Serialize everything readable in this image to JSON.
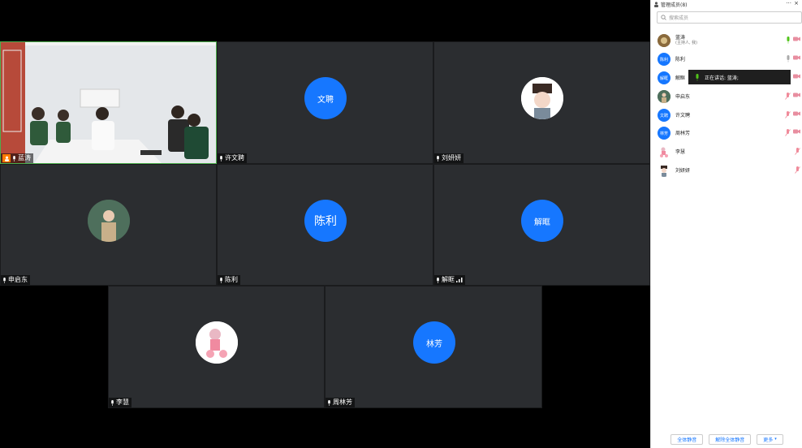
{
  "panel": {
    "title": "管理成员(8)",
    "more": "···",
    "close": "×",
    "search_placeholder": "搜索成员",
    "members": [
      {
        "name": "蓝涛",
        "sub": "(主持人, 我)",
        "avatar": "",
        "mic_on": true
      },
      {
        "name": "陈利",
        "sub": "",
        "avatar": "陈利",
        "mic_on": true
      },
      {
        "name": "解眶",
        "sub": "",
        "avatar": "解眶",
        "mic_on": true
      },
      {
        "name": "申启东",
        "sub": "",
        "avatar": "",
        "mic_on": false
      },
      {
        "name": "许文聘",
        "sub": "",
        "avatar": "文聘",
        "mic_on": false
      },
      {
        "name": "周林芳",
        "sub": "",
        "avatar": "林芳",
        "mic_on": false
      },
      {
        "name": "李慧",
        "sub": "",
        "avatar": "",
        "mic_on": false
      },
      {
        "name": "刘妍妍",
        "sub": "",
        "avatar": "",
        "mic_on": false
      }
    ],
    "tooltip": "正在讲话: 蓝涛;",
    "footer": {
      "mute_all": "全体静音",
      "unmute_all": "解除全体静音",
      "more": "更多"
    }
  },
  "tiles": [
    {
      "name": "蓝涛",
      "avatar": ""
    },
    {
      "name": "许文聘",
      "avatar": "文聘"
    },
    {
      "name": "刘妍妍",
      "avatar": ""
    },
    {
      "name": "申启东",
      "avatar": ""
    },
    {
      "name": "陈利",
      "avatar": "陈利"
    },
    {
      "name": "解眶",
      "avatar": "解眶"
    },
    {
      "name": "李慧",
      "avatar": ""
    },
    {
      "name": "周林芳",
      "avatar": "林芳"
    }
  ],
  "colors": {
    "accent": "#1677ff",
    "host_badge": "#ff7a00",
    "tile_bg": "#2b2d30",
    "active_border": "#4cae4c"
  }
}
